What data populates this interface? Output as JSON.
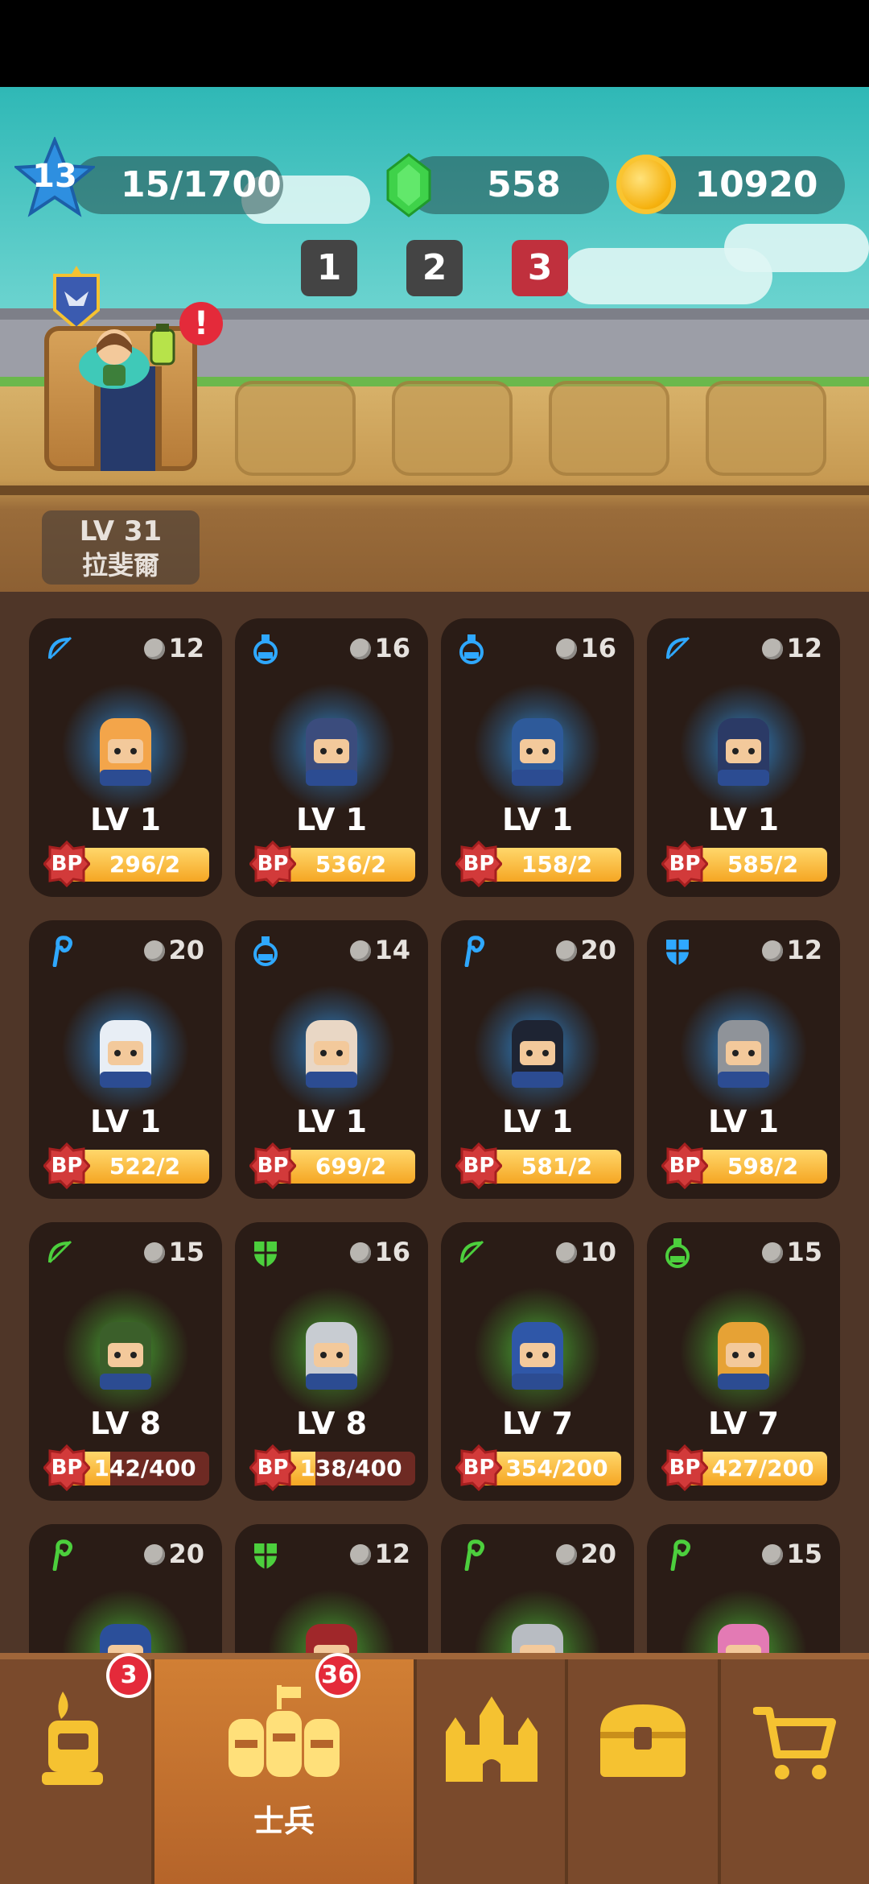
{
  "player": {
    "level": "13",
    "xp": "15/1700"
  },
  "currency": {
    "gems": "558",
    "coins": "10920"
  },
  "waves": [
    "1",
    "2",
    "3"
  ],
  "hero": {
    "level": "LV 31",
    "name": "拉斐爾"
  },
  "alert_mark": "!",
  "colors": {
    "wave_active": "#c0303d",
    "wave_inactive": "#444444",
    "blue_glow": "#2fa0ff",
    "green_glow": "#50d23c"
  },
  "cards": [
    {
      "class_icon": "bow-icon",
      "cost": "12",
      "level": "LV 1",
      "bp": "296/2",
      "progress": 1.0,
      "glow": "blue"
    },
    {
      "class_icon": "potion-icon",
      "cost": "16",
      "level": "LV 1",
      "bp": "536/2",
      "progress": 1.0,
      "glow": "blue"
    },
    {
      "class_icon": "potion-icon",
      "cost": "16",
      "level": "LV 1",
      "bp": "158/2",
      "progress": 1.0,
      "glow": "blue"
    },
    {
      "class_icon": "bow-icon",
      "cost": "12",
      "level": "LV 1",
      "bp": "585/2",
      "progress": 1.0,
      "glow": "blue"
    },
    {
      "class_icon": "staff-icon",
      "cost": "20",
      "level": "LV 1",
      "bp": "522/2",
      "progress": 1.0,
      "glow": "blue"
    },
    {
      "class_icon": "potion-icon",
      "cost": "14",
      "level": "LV 1",
      "bp": "699/2",
      "progress": 1.0,
      "glow": "blue"
    },
    {
      "class_icon": "staff-icon",
      "cost": "20",
      "level": "LV 1",
      "bp": "581/2",
      "progress": 1.0,
      "glow": "blue"
    },
    {
      "class_icon": "shield-icon",
      "cost": "12",
      "level": "LV 1",
      "bp": "598/2",
      "progress": 1.0,
      "glow": "blue"
    },
    {
      "class_icon": "bow-icon",
      "cost": "15",
      "level": "LV 8",
      "bp": "142/400",
      "progress": 0.355,
      "glow": "green"
    },
    {
      "class_icon": "shield-icon",
      "cost": "16",
      "level": "LV 8",
      "bp": "138/400",
      "progress": 0.345,
      "glow": "green"
    },
    {
      "class_icon": "bow-icon",
      "cost": "10",
      "level": "LV 7",
      "bp": "354/200",
      "progress": 1.0,
      "glow": "green"
    },
    {
      "class_icon": "potion-icon",
      "cost": "15",
      "level": "LV 7",
      "bp": "427/200",
      "progress": 1.0,
      "glow": "green"
    },
    {
      "class_icon": "staff-icon",
      "cost": "20",
      "level": "",
      "bp": "",
      "progress": 0,
      "glow": "green"
    },
    {
      "class_icon": "shield-icon",
      "cost": "12",
      "level": "",
      "bp": "",
      "progress": 0,
      "glow": "green"
    },
    {
      "class_icon": "staff-icon",
      "cost": "20",
      "level": "",
      "bp": "",
      "progress": 0,
      "glow": "green"
    },
    {
      "class_icon": "staff-icon",
      "cost": "15",
      "level": "",
      "bp": "",
      "progress": 0,
      "glow": "green"
    }
  ],
  "bp_label": "BP",
  "nav": {
    "heroes_badge": "3",
    "soldiers_badge": "36",
    "soldiers_label": "士兵"
  }
}
